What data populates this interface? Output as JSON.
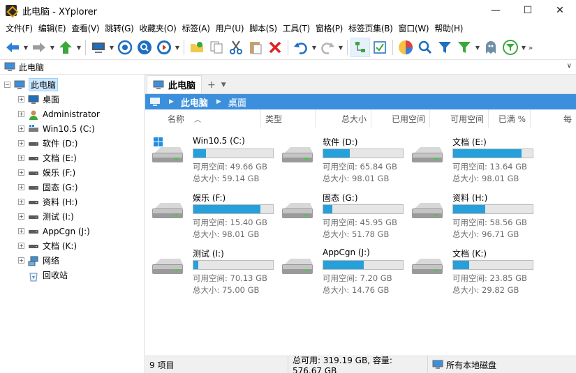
{
  "window": {
    "title": "此电脑 - XYplorer",
    "minimize": "—",
    "maximize": "☐",
    "close": "✕"
  },
  "menu": [
    "文件(F)",
    "编辑(E)",
    "查看(V)",
    "跳转(G)",
    "收藏夹(O)",
    "标签(A)",
    "用户(U)",
    "脚本(S)",
    "工具(T)",
    "窗格(P)",
    "标签页集(B)",
    "窗口(W)",
    "帮助(H)"
  ],
  "address": {
    "text": "此电脑"
  },
  "tree": [
    {
      "label": "此电脑",
      "icon": "computer-icon",
      "expander": "−",
      "selected": true
    },
    {
      "label": "桌面",
      "icon": "desktop-icon",
      "expander": "+"
    },
    {
      "label": "Administrator",
      "icon": "user-icon",
      "expander": "+"
    },
    {
      "label": "Win10.5 (C:)",
      "icon": "system-drive-icon",
      "expander": "+"
    },
    {
      "label": "软件 (D:)",
      "icon": "drive-icon",
      "expander": "+"
    },
    {
      "label": "文档 (E:)",
      "icon": "drive-icon",
      "expander": "+"
    },
    {
      "label": "娱乐 (F:)",
      "icon": "drive-icon",
      "expander": "+"
    },
    {
      "label": "固态 (G:)",
      "icon": "drive-icon",
      "expander": "+"
    },
    {
      "label": "资料 (H:)",
      "icon": "drive-icon",
      "expander": "+"
    },
    {
      "label": "测试 (I:)",
      "icon": "drive-icon",
      "expander": "+"
    },
    {
      "label": "AppCgn (J:)",
      "icon": "drive-icon",
      "expander": "+"
    },
    {
      "label": "文档 (K:)",
      "icon": "drive-icon",
      "expander": "+"
    },
    {
      "label": "网络",
      "icon": "network-icon",
      "expander": "+"
    },
    {
      "label": "回收站",
      "icon": "recycle-bin-icon",
      "expander": ""
    }
  ],
  "tab": {
    "label": "此电脑",
    "plus": "+",
    "dd": "▼"
  },
  "breadcrumb": {
    "item1": "此电脑",
    "item2": "桌面"
  },
  "columns": [
    "名称",
    "类型",
    "总大小",
    "已用空间",
    "可用空间",
    "已满 %",
    "每"
  ],
  "drives": [
    {
      "name": "Win10.5 (C:)",
      "free": "可用空间: 49.66 GB",
      "total": "总大小: 59.14 GB",
      "used_fraction": 0.16,
      "system": true
    },
    {
      "name": "软件 (D:)",
      "free": "可用空间: 65.84 GB",
      "total": "总大小: 98.01 GB",
      "used_fraction": 0.33
    },
    {
      "name": "文档 (E:)",
      "free": "可用空间: 13.64 GB",
      "total": "总大小: 98.01 GB",
      "used_fraction": 0.86
    },
    {
      "name": "娱乐 (F:)",
      "free": "可用空间: 15.40 GB",
      "total": "总大小: 98.01 GB",
      "used_fraction": 0.84
    },
    {
      "name": "固态 (G:)",
      "free": "可用空间: 45.95 GB",
      "total": "总大小: 51.78 GB",
      "used_fraction": 0.11
    },
    {
      "name": "资料 (H:)",
      "free": "可用空间: 58.56 GB",
      "total": "总大小: 96.71 GB",
      "used_fraction": 0.4
    },
    {
      "name": "测试 (I:)",
      "free": "可用空间: 70.13 GB",
      "total": "总大小: 75.00 GB",
      "used_fraction": 0.06
    },
    {
      "name": "AppCgn (J:)",
      "free": "可用空间: 7.20 GB",
      "total": "总大小: 14.76 GB",
      "used_fraction": 0.51
    },
    {
      "name": "文档 (K:)",
      "free": "可用空间: 23.85 GB",
      "total": "总大小: 29.82 GB",
      "used_fraction": 0.2
    }
  ],
  "status": {
    "items": "9 项目",
    "totals": "总可用: 319.19 GB, 容量: 576.67 GB",
    "scope": "所有本地磁盘"
  },
  "colors": {
    "accent": "#3c8fdc",
    "bar": "#26a0da"
  }
}
